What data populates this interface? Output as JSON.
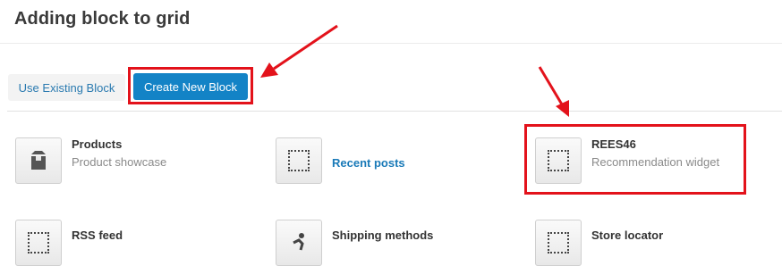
{
  "dialog": {
    "title": "Adding block to grid"
  },
  "tabs": {
    "existing_label": "Use Existing Block",
    "create_label": "Create New Block"
  },
  "blocks": [
    {
      "name": "Products",
      "description": "Product showcase",
      "icon": "box-icon"
    },
    {
      "name": "Recent posts",
      "description": "",
      "icon": "dotted-square-icon"
    },
    {
      "name": "REES46",
      "description": "Recommendation widget",
      "icon": "dotted-square-icon"
    },
    {
      "name": "RSS feed",
      "description": "",
      "icon": "dotted-square-icon"
    },
    {
      "name": "Shipping methods",
      "description": "",
      "icon": "delivery-person-icon"
    },
    {
      "name": "Store locator",
      "description": "",
      "icon": "dotted-square-icon"
    }
  ],
  "colors": {
    "accent": "#1383c6",
    "annotation": "#e3121b",
    "link": "#1a7ab8"
  }
}
